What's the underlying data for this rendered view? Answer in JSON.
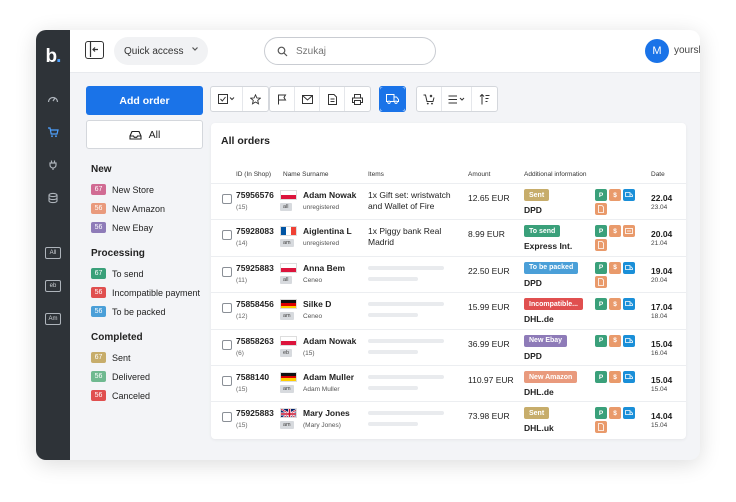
{
  "topbar": {
    "quick_access": "Quick access",
    "search_placeholder": "Szukaj",
    "avatar_letter": "M",
    "user_name": "yourshop"
  },
  "rail": {
    "logo": "b",
    "tags": [
      "All",
      "eb",
      "Am"
    ]
  },
  "actions": {
    "add_order": "Add order",
    "all": "All"
  },
  "groups": {
    "new": {
      "title": "New",
      "items": [
        {
          "count": "67",
          "label": "New Store",
          "color": "#d16b93"
        },
        {
          "count": "56",
          "label": "New Amazon",
          "color": "#e99a7d"
        },
        {
          "count": "56",
          "label": "New Ebay",
          "color": "#8e7bb8"
        }
      ]
    },
    "processing": {
      "title": "Processing",
      "items": [
        {
          "count": "67",
          "label": "To send",
          "color": "#3aa07a"
        },
        {
          "count": "56",
          "label": "Incompatible payment",
          "color": "#e04f4f"
        },
        {
          "count": "56",
          "label": "To be packed",
          "color": "#4a9fd8"
        }
      ]
    },
    "completed": {
      "title": "Completed",
      "items": [
        {
          "count": "67",
          "label": "Sent",
          "color": "#c7ad6b"
        },
        {
          "count": "56",
          "label": "Delivered",
          "color": "#6fb990"
        },
        {
          "count": "56",
          "label": "Canceled",
          "color": "#e04f4f"
        }
      ]
    }
  },
  "orders": {
    "title": "All orders",
    "columns": {
      "id": "ID (In Shop)",
      "name": "Name Surname",
      "items": "Items",
      "amount": "Amount",
      "info": "Additional information",
      "date": "Date"
    },
    "rows": [
      {
        "id": "75956576",
        "shop_id": "(15)",
        "flag": "pl",
        "source": "all",
        "name": "Adam Nowak",
        "sub": "unregistered",
        "items": "1x Gift set: wristwatch and Wallet of Fire",
        "amount": "12.65 EUR",
        "status": "Sent",
        "status_color": "#c7ad6b",
        "carrier": "DPD",
        "icons": [
          "P",
          "$",
          "truck",
          "doc"
        ],
        "date": "22.04",
        "date_sub": "23.04"
      },
      {
        "id": "75928083",
        "shop_id": "(14)",
        "flag": "fr",
        "source": "am",
        "name": "Aiglentina L",
        "sub": "unregistered",
        "items": "1x Piggy bank Real Madrid",
        "amount": "8.99 EUR",
        "status": "To send",
        "status_color": "#3aa07a",
        "carrier": "Express Int.",
        "icons": [
          "P",
          "$",
          "inv",
          "doc"
        ],
        "date": "20.04",
        "date_sub": "21.04"
      },
      {
        "id": "75925883",
        "shop_id": "(11)",
        "flag": "pl",
        "source": "all",
        "name": "Anna Bem",
        "sub": "Ceneo",
        "items": "",
        "amount": "22.50 EUR",
        "status": "To be packed",
        "status_color": "#4a9fd8",
        "carrier": "DPD",
        "icons": [
          "P",
          "$",
          "truck",
          "doc"
        ],
        "date": "19.04",
        "date_sub": "20.04"
      },
      {
        "id": "75858456",
        "shop_id": "(12)",
        "flag": "de",
        "source": "am",
        "name": "Silke D",
        "sub": "Ceneo",
        "items": "",
        "amount": "15.99 EUR",
        "status": "Incompatible...",
        "status_color": "#e04f4f",
        "carrier": "DHL.de",
        "icons": [
          "P",
          "$",
          "truck"
        ],
        "date": "17.04",
        "date_sub": "18.04"
      },
      {
        "id": "75858263",
        "shop_id": "(6)",
        "flag": "pl",
        "source": "eb",
        "name": "Adam Nowak",
        "sub": "(15)",
        "items": "",
        "amount": "36.99 EUR",
        "status": "New Ebay",
        "status_color": "#8e7bb8",
        "carrier": "DPD",
        "icons": [
          "P",
          "$",
          "truck"
        ],
        "date": "15.04",
        "date_sub": "16.04"
      },
      {
        "id": "7588140",
        "shop_id": "(15)",
        "flag": "de",
        "source": "am",
        "name": "Adam Muller",
        "sub": "Adam Muller",
        "items": "",
        "amount": "110.97 EUR",
        "status": "New Amazon",
        "status_color": "#e99a7d",
        "carrier": "DHL.de",
        "icons": [
          "P",
          "$",
          "truck"
        ],
        "date": "15.04",
        "date_sub": "15.04"
      },
      {
        "id": "75925883",
        "shop_id": "(15)",
        "flag": "gb",
        "source": "am",
        "name": "Mary Jones",
        "sub": "(Mary Jones)",
        "items": "",
        "amount": "73.98 EUR",
        "status": "Sent",
        "status_color": "#c7ad6b",
        "carrier": "DHL.uk",
        "icons": [
          "P",
          "$",
          "truck",
          "doc"
        ],
        "date": "14.04",
        "date_sub": "15.04"
      }
    ]
  },
  "colors": {
    "accent": "#1a73e8",
    "rail": "#2e3338",
    "icon_p": "#3aa07a",
    "icon_dollar": "#e99a6b",
    "icon_truck": "#1a8fd8",
    "icon_doc": "#e99a6b"
  }
}
